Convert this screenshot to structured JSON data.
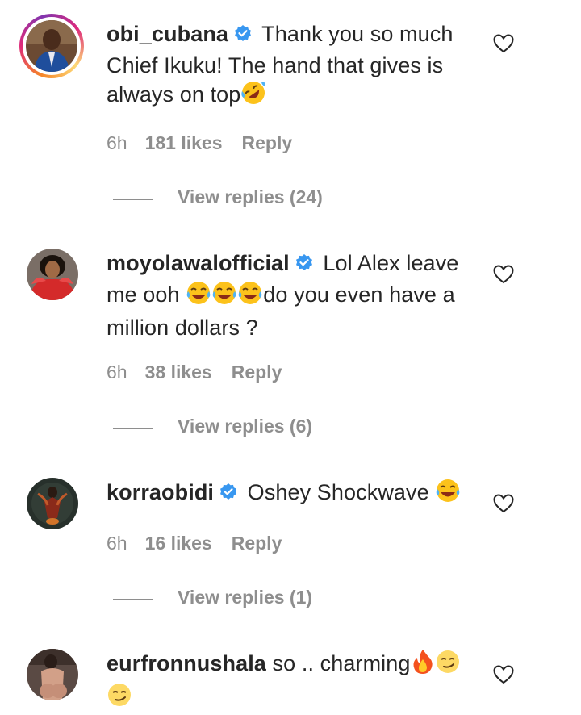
{
  "comments": [
    {
      "username": "obi_cubana",
      "text": "Thank you so much Chief Ikuku! The hand that gives is always on top",
      "emojis": [
        "rolling-on-floor-laughing-emoji"
      ],
      "time": "6h",
      "likes": "181 likes",
      "reply": "Reply",
      "view_replies": "View replies (24)",
      "verified": true,
      "has_story_ring": true
    },
    {
      "username": "moyolawalofficial",
      "text_before": "Lol Alex leave me ooh ",
      "text_after": "do you even have a million dollars ?",
      "emojis": [
        "tears-of-joy-emoji",
        "tears-of-joy-emoji",
        "tears-of-joy-emoji"
      ],
      "time": "6h",
      "likes": "38 likes",
      "reply": "Reply",
      "view_replies": "View replies (6)",
      "verified": true
    },
    {
      "username": "korraobidi",
      "text": "Oshey Shockwave ",
      "emojis": [
        "tears-of-joy-emoji"
      ],
      "time": "6h",
      "likes": "16 likes",
      "reply": "Reply",
      "view_replies": "View replies (1)",
      "verified": true
    },
    {
      "username": "eurfronnushala",
      "text": "so .. charming",
      "emojis": [
        "fire-emoji",
        "smirking-face-emoji",
        "smirking-face-emoji"
      ],
      "verified": false
    }
  ],
  "colors": {
    "text": "#262626",
    "secondary": "#8e8e8e",
    "verified_badge": "#3897f0",
    "emoji_yellow": "#fcc21b"
  }
}
